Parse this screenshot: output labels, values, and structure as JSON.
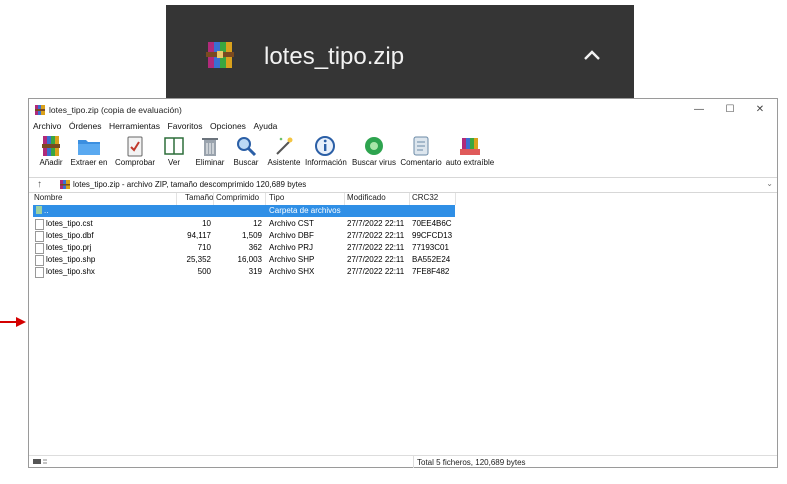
{
  "download": {
    "filename": "lotes_tipo.zip"
  },
  "window": {
    "title": "lotes_tipo.zip (copia de evaluación)",
    "controls": {
      "minimize": "—",
      "maximize": "☐",
      "close": "✕"
    }
  },
  "menu": [
    "Archivo",
    "Órdenes",
    "Herramientas",
    "Favoritos",
    "Opciones",
    "Ayuda"
  ],
  "toolbar": [
    {
      "label": "Añadir",
      "icon": "add-archive-icon"
    },
    {
      "label": "Extraer en",
      "icon": "extract-folder-icon"
    },
    {
      "label": "Comprobar",
      "icon": "test-clipboard-icon"
    },
    {
      "label": "Ver",
      "icon": "view-book-icon"
    },
    {
      "label": "Eliminar",
      "icon": "trash-icon"
    },
    {
      "label": "Buscar",
      "icon": "search-magnifier-icon"
    },
    {
      "label": "Asistente",
      "icon": "wizard-wand-icon"
    },
    {
      "label": "Información",
      "icon": "info-icon"
    },
    {
      "label": "Buscar virus",
      "icon": "virus-scan-icon"
    },
    {
      "label": "Comentario",
      "icon": "comment-icon"
    },
    {
      "label": "auto extraíble",
      "icon": "sfx-icon"
    }
  ],
  "address": {
    "up": "↑",
    "path": "lotes_tipo.zip - archivo ZIP, tamaño descomprimido 120,689 bytes",
    "dropdown": "⌄"
  },
  "columns": {
    "name": "Nombre",
    "size": "Tamaño",
    "packed": "Comprimido",
    "type": "Tipo",
    "modified": "Modificado",
    "crc": "CRC32"
  },
  "parent_row": {
    "name": "..",
    "type": "Carpeta de archivos"
  },
  "files": [
    {
      "name": "lotes_tipo.cst",
      "size": "10",
      "packed": "12",
      "type": "Archivo CST",
      "modified": "27/7/2022 22:11",
      "crc": "70EE4B6C"
    },
    {
      "name": "lotes_tipo.dbf",
      "size": "94,117",
      "packed": "1,509",
      "type": "Archivo DBF",
      "modified": "27/7/2022 22:11",
      "crc": "99CFCD13"
    },
    {
      "name": "lotes_tipo.prj",
      "size": "710",
      "packed": "362",
      "type": "Archivo PRJ",
      "modified": "27/7/2022 22:11",
      "crc": "77193C01"
    },
    {
      "name": "lotes_tipo.shp",
      "size": "25,352",
      "packed": "16,003",
      "type": "Archivo SHP",
      "modified": "27/7/2022 22:11",
      "crc": "BA552E24"
    },
    {
      "name": "lotes_tipo.shx",
      "size": "500",
      "packed": "319",
      "type": "Archivo SHX",
      "modified": "27/7/2022 22:11",
      "crc": "7FE8F482"
    }
  ],
  "status": {
    "total": "Total 5 ficheros, 120,689 bytes"
  },
  "colors": {
    "download_bar": "#353535",
    "selection": "#2f8fe6",
    "arrow": "#d40000"
  }
}
